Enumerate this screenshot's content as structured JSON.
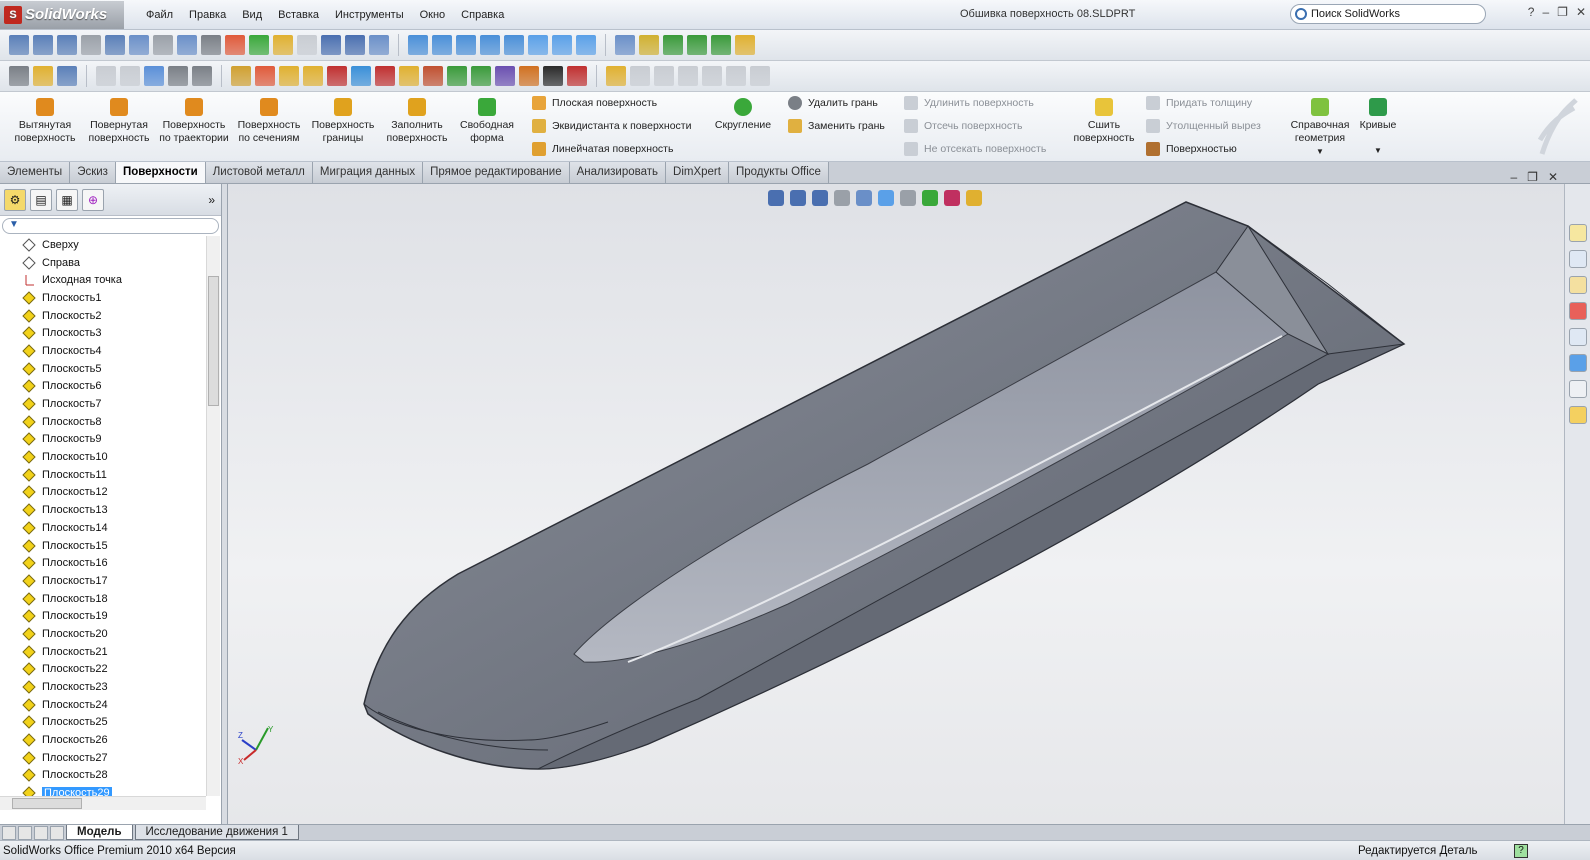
{
  "app": {
    "brand": "SolidWorks",
    "doc_title": "Обшивка поверхность 08.SLDPRT",
    "search_placeholder": "Поиск SolidWorks"
  },
  "menu": [
    "Файл",
    "Правка",
    "Вид",
    "Вставка",
    "Инструменты",
    "Окно",
    "Справка"
  ],
  "ribbon": {
    "big": [
      {
        "label": "Вытянутая поверхность",
        "color": "#e08a1e"
      },
      {
        "label": "Повернутая поверхность",
        "color": "#e08a1e"
      },
      {
        "label": "Поверхность по траектории",
        "color": "#e08a1e"
      },
      {
        "label": "Поверхность по сечениям",
        "color": "#e08a1e"
      },
      {
        "label": "Поверхность границы",
        "color": "#e0a21e"
      },
      {
        "label": "Заполнить поверхность",
        "color": "#e0a21e"
      },
      {
        "label": "Свободная форма",
        "color": "#3aa83a"
      }
    ],
    "col1": [
      "Плоская поверхность",
      "Эквидистанта к поверхности",
      "Линейчатая поверхность"
    ],
    "fillet": "Скругление",
    "col2": [
      "Удалить грань",
      "Заменить грань"
    ],
    "col3": [
      "Удлинить поверхность",
      "Отсечь поверхность",
      "Не отсекать поверхность"
    ],
    "knit": "Сшить поверхность",
    "col4": [
      "Придать толщину",
      "Утолщенный вырез",
      "Поверхностью"
    ],
    "refgeom": "Справочная геометрия",
    "curves": "Кривые"
  },
  "tabs": [
    "Элементы",
    "Эскиз",
    "Поверхности",
    "Листовой металл",
    "Миграция данных",
    "Прямое редактирование",
    "Анализировать",
    "DimXpert",
    "Продукты Office"
  ],
  "active_tab": "Поверхности",
  "tree": {
    "items": [
      "Сверху",
      "Справа",
      "Исходная точка",
      "Плоскость1",
      "Плоскость2",
      "Плоскость3",
      "Плоскость4",
      "Плоскость5",
      "Плоскость6",
      "Плоскость7",
      "Плоскость8",
      "Плоскость9",
      "Плоскость10",
      "Плоскость11",
      "Плоскость12",
      "Плоскость13",
      "Плоскость14",
      "Плоскость15",
      "Плоскость16",
      "Плоскость17",
      "Плоскость18",
      "Плоскость19",
      "Плоскость20",
      "Плоскость21",
      "Плоскость22",
      "Плоскость23",
      "Плоскость24",
      "Плоскость25",
      "Плоскость26",
      "Плоскость27",
      "Плоскость28",
      "Плоскость29"
    ],
    "selected": "Плоскость29"
  },
  "bottom_tabs": [
    "Модель",
    "Исследование движения 1"
  ],
  "status": {
    "left": "SolidWorks Office Premium 2010 x64 Версия",
    "right": "Редактируется Деталь",
    "help": "?"
  },
  "colors": {
    "hull": "#6f7480",
    "hull_light": "#9ea3ad",
    "plane_icon": "#f2d21a",
    "accent": "#3399ff"
  }
}
